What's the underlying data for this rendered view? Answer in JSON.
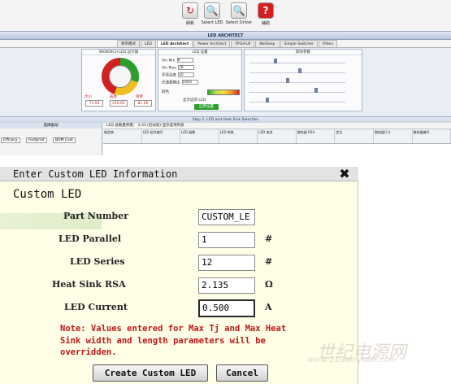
{
  "toolbar": {
    "buttons": [
      {
        "label": "刷新",
        "icon": "refresh-icon"
      },
      {
        "label": "Select LED",
        "icon": "zoom-led-icon"
      },
      {
        "label": "Select Driver",
        "icon": "zoom-driver-icon"
      },
      {
        "label": "辅助",
        "icon": "help-icon"
      }
    ]
  },
  "app": {
    "title": "LED ARCHITECT",
    "tabs": [
      "简单模式",
      "LED",
      "LED Architect",
      "Power Architect",
      "FPGA/uP",
      "NetSeep",
      "Simple Switcher",
      "Filters"
    ],
    "active_tab": 2,
    "panels": {
      "left": "WEBENCH LED 设计器",
      "middle": "LED 设置",
      "right": "影响参数"
    },
    "values": {
      "size_label": "大小",
      "size": "73.00",
      "cost_label": "成本",
      "cost": "$10.61",
      "eff_label": "效率",
      "eff": "81.00"
    },
    "mid_rows": [
      "Vin Min",
      "Vin Max",
      "环境温度",
      "光通量输出",
      "颜色"
    ],
    "mid_values": {
      "vin_min": "8",
      "vin_max": "18",
      "ambient": "30",
      "flux": "1000"
    },
    "show_opt": "显示选项 LED",
    "apply_btn": "应用设置",
    "step_title": "Step 1: LED and Heat Sink Selection",
    "left_pane_title": "选择驱动",
    "left_selects": [
      "Efficacy",
      "Footprint",
      "BOM Cost"
    ],
    "right_bar": "LED 总数量所需： 3.33 (近似值)  显示选项列表",
    "right_cols": [
      "制造商",
      "LED 组件编号",
      "LED 级数",
      "LED 串联",
      "LED 电流",
      "散热器 RSA",
      "定位",
      "散热器尺寸",
      "散热器编号"
    ]
  },
  "dialog": {
    "title": "Enter Custom LED Information",
    "heading": "Custom LED",
    "fields": [
      {
        "label": "Part Number",
        "value": "CUSTOM_LE",
        "unit": ""
      },
      {
        "label": "LED Parallel",
        "value": "1",
        "unit": "#"
      },
      {
        "label": "LED Series",
        "value": "12",
        "unit": "#"
      },
      {
        "label": "Heat Sink RSA",
        "value": "2.135",
        "unit": "Ω"
      },
      {
        "label": "LED Current",
        "value": "0.500",
        "unit": "A"
      }
    ],
    "note": "Note: Values entered for Max Tj and Max Heat Sink width and length parameters will be overridden.",
    "create_button": "Create Custom LED",
    "cancel_button": "Cancel",
    "close_glyph": "✖"
  },
  "watermark": {
    "main": "世纪电源网",
    "sub": "www.21dianyuan.com"
  },
  "colors": {
    "note_red": "#c01818",
    "dialog_bg": "#fffee6",
    "title_bar": "#e3e3e3"
  }
}
